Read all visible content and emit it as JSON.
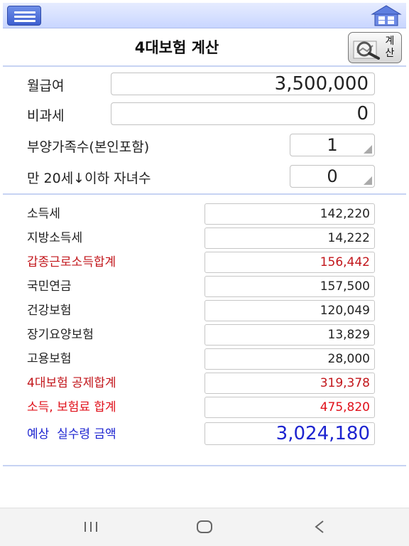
{
  "header": {
    "title": "4대보험 계산",
    "calc_button_label": "계산",
    "menu_icon": "hamburger-menu-icon",
    "home_icon": "home-icon"
  },
  "inputs": {
    "salary": {
      "label": "월급여",
      "value": "3,500,000"
    },
    "nontax": {
      "label": "비과세",
      "value": "0"
    },
    "dependents": {
      "label": "부양가족수(본인포함)",
      "value": "1"
    },
    "children": {
      "label": "만 20세↓이하 자녀수",
      "value": "0"
    }
  },
  "results": [
    {
      "label": "소득세",
      "value": "142,220",
      "style": "normal"
    },
    {
      "label": "지방소득세",
      "value": "14,222",
      "style": "normal"
    },
    {
      "label": "갑종근로소득합계",
      "value": "156,442",
      "style": "red"
    },
    {
      "label": "국민연금",
      "value": "157,500",
      "style": "normal"
    },
    {
      "label": "건강보험",
      "value": "120,049",
      "style": "normal"
    },
    {
      "label": "장기요양보험",
      "value": "13,829",
      "style": "normal"
    },
    {
      "label": "고용보험",
      "value": "28,000",
      "style": "normal"
    },
    {
      "label": "4대보험 공제합계",
      "value": "319,378",
      "style": "red"
    },
    {
      "label": "소득, 보험료 합계",
      "value": "475,820",
      "style": "brightred"
    },
    {
      "label": "예상  실수령 금액",
      "value": "3,024,180",
      "style": "blue"
    }
  ],
  "colors": {
    "accent_blue": "#3e5fd0",
    "red_total": "#c2161b",
    "bright_red": "#e0101a",
    "net_blue": "#1d24d0"
  },
  "navbar": {
    "recent_icon": "recent-apps-icon",
    "home_icon": "nav-home-icon",
    "back_icon": "back-icon"
  }
}
